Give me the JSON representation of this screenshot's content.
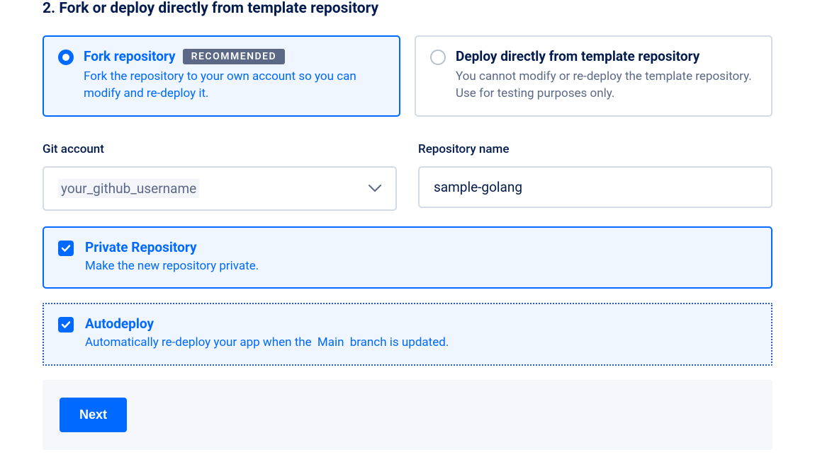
{
  "section": {
    "title": "2. Fork or deploy directly from template repository"
  },
  "options": {
    "fork": {
      "title": "Fork repository",
      "badge": "RECOMMENDED",
      "desc": "Fork the repository to your own account so you can modify and re-deploy it."
    },
    "deploy": {
      "title": "Deploy directly from template repository",
      "desc": "You cannot modify or re-deploy the template repository. Use for testing purposes only."
    }
  },
  "fields": {
    "git_account": {
      "label": "Git account",
      "value": "your_github_username"
    },
    "repo_name": {
      "label": "Repository name",
      "value": "sample-golang"
    }
  },
  "checkboxes": {
    "private_repo": {
      "title": "Private Repository",
      "desc": "Make the new repository private."
    },
    "autodeploy": {
      "title": "Autodeploy",
      "desc_pre": "Automatically re-deploy your app when the ",
      "branch": "Main",
      "desc_post": " branch is updated."
    }
  },
  "buttons": {
    "next": "Next"
  }
}
